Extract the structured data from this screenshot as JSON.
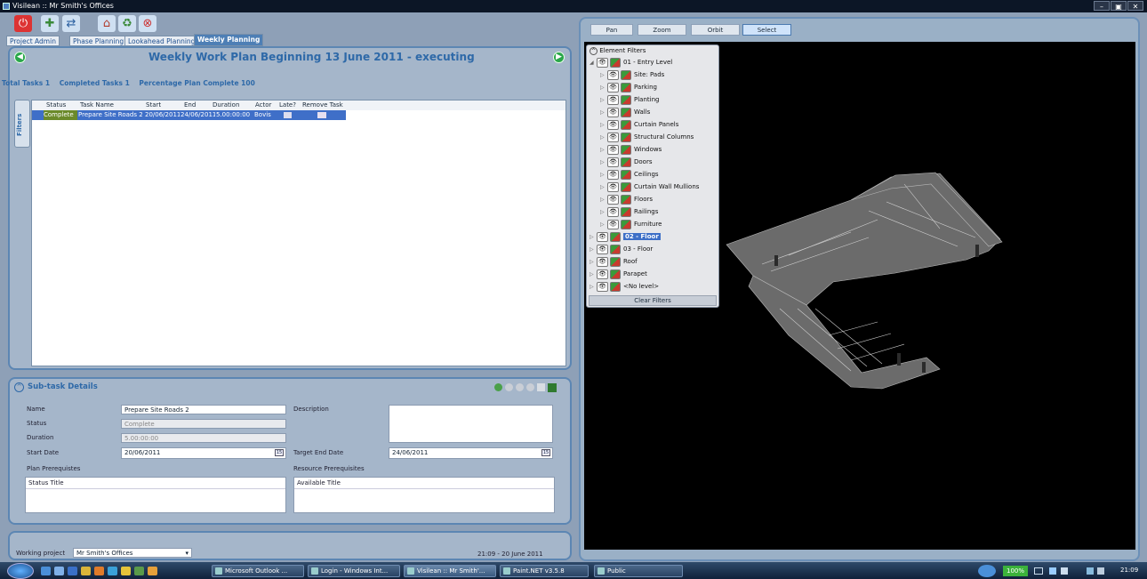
{
  "window": {
    "title": "Visilean :: Mr Smith's Offices",
    "controls": [
      "–",
      "▣",
      "✕"
    ]
  },
  "tabs": [
    {
      "label": "Project Admin"
    },
    {
      "label": "Phase Planning"
    },
    {
      "label": "Lookahead Planning"
    },
    {
      "label": "Weekly Planning"
    }
  ],
  "plan": {
    "title": "Weekly Work Plan Beginning 13 June 2011 - executing",
    "total_tasks": "Total Tasks  1",
    "completed_tasks": "Completed Tasks  1",
    "ppc": "Percentage Plan Complete  100",
    "filters_label": "Filters",
    "columns": [
      "Status",
      "Task Name",
      "Start",
      "End",
      "Duration",
      "Actor",
      "Late?",
      "Remove Task"
    ],
    "rows": [
      {
        "status": "Complete",
        "task_name": "Prepare Site Roads 2",
        "start": "20/06/2011",
        "end": "24/06/2011",
        "duration": "5.00:00:00",
        "actor": "Bovis"
      }
    ]
  },
  "subtask": {
    "title": "Sub-task Details",
    "name_label": "Name",
    "name_value": "Prepare Site Roads 2",
    "status_label": "Status",
    "status_value": "Complete",
    "duration_label": "Duration",
    "duration_value": "5.00:00:00",
    "start_label": "Start Date",
    "start_value": "20/06/2011",
    "desc_label": "Description",
    "target_label": "Target End Date",
    "target_value": "24/06/2011",
    "plan_prereq_label": "Plan Prerequistes",
    "plan_prereq_cols": "Status Title",
    "res_prereq_label": "Resource Prerequisites",
    "res_prereq_cols": "Available Title",
    "cal_glyph": "15"
  },
  "footer": {
    "working_project_label": "Working project",
    "working_project_value": "Mr Smith's Offices",
    "clock": "21:09 - 20 June 2011"
  },
  "viewer": {
    "buttons": [
      "Pan",
      "Zoom",
      "Orbit",
      "Select"
    ],
    "active": "Select"
  },
  "element_filters": {
    "title": "Element Filters",
    "levels": [
      {
        "label": "01 - Entry Level",
        "expanded": true,
        "children": [
          "Site: Pads",
          "Parking",
          "Planting",
          "Walls",
          "Curtain Panels",
          "Structural Columns",
          "Windows",
          "Doors",
          "Ceilings",
          "Curtain Wall Mullions",
          "Floors",
          "Railings",
          "Furniture"
        ]
      },
      {
        "label": "02 - Floor",
        "selected": true
      },
      {
        "label": "03 - Floor"
      },
      {
        "label": "Roof"
      },
      {
        "label": "Parapet"
      },
      {
        "label": "<No level>"
      }
    ],
    "clear_label": "Clear Filters"
  },
  "taskbar": {
    "items": [
      "Microsoft Outlook ...",
      "Login - Windows Int...",
      "Visilean :: Mr Smith'...",
      "Paint.NET v3.5.8",
      "Public"
    ],
    "zoom": "100%",
    "time": "21:09"
  },
  "colors": {
    "accent": "#2e69a8",
    "selection": "#3f6fc8",
    "panel": "#a5b6ca",
    "viewport": "#000000"
  }
}
